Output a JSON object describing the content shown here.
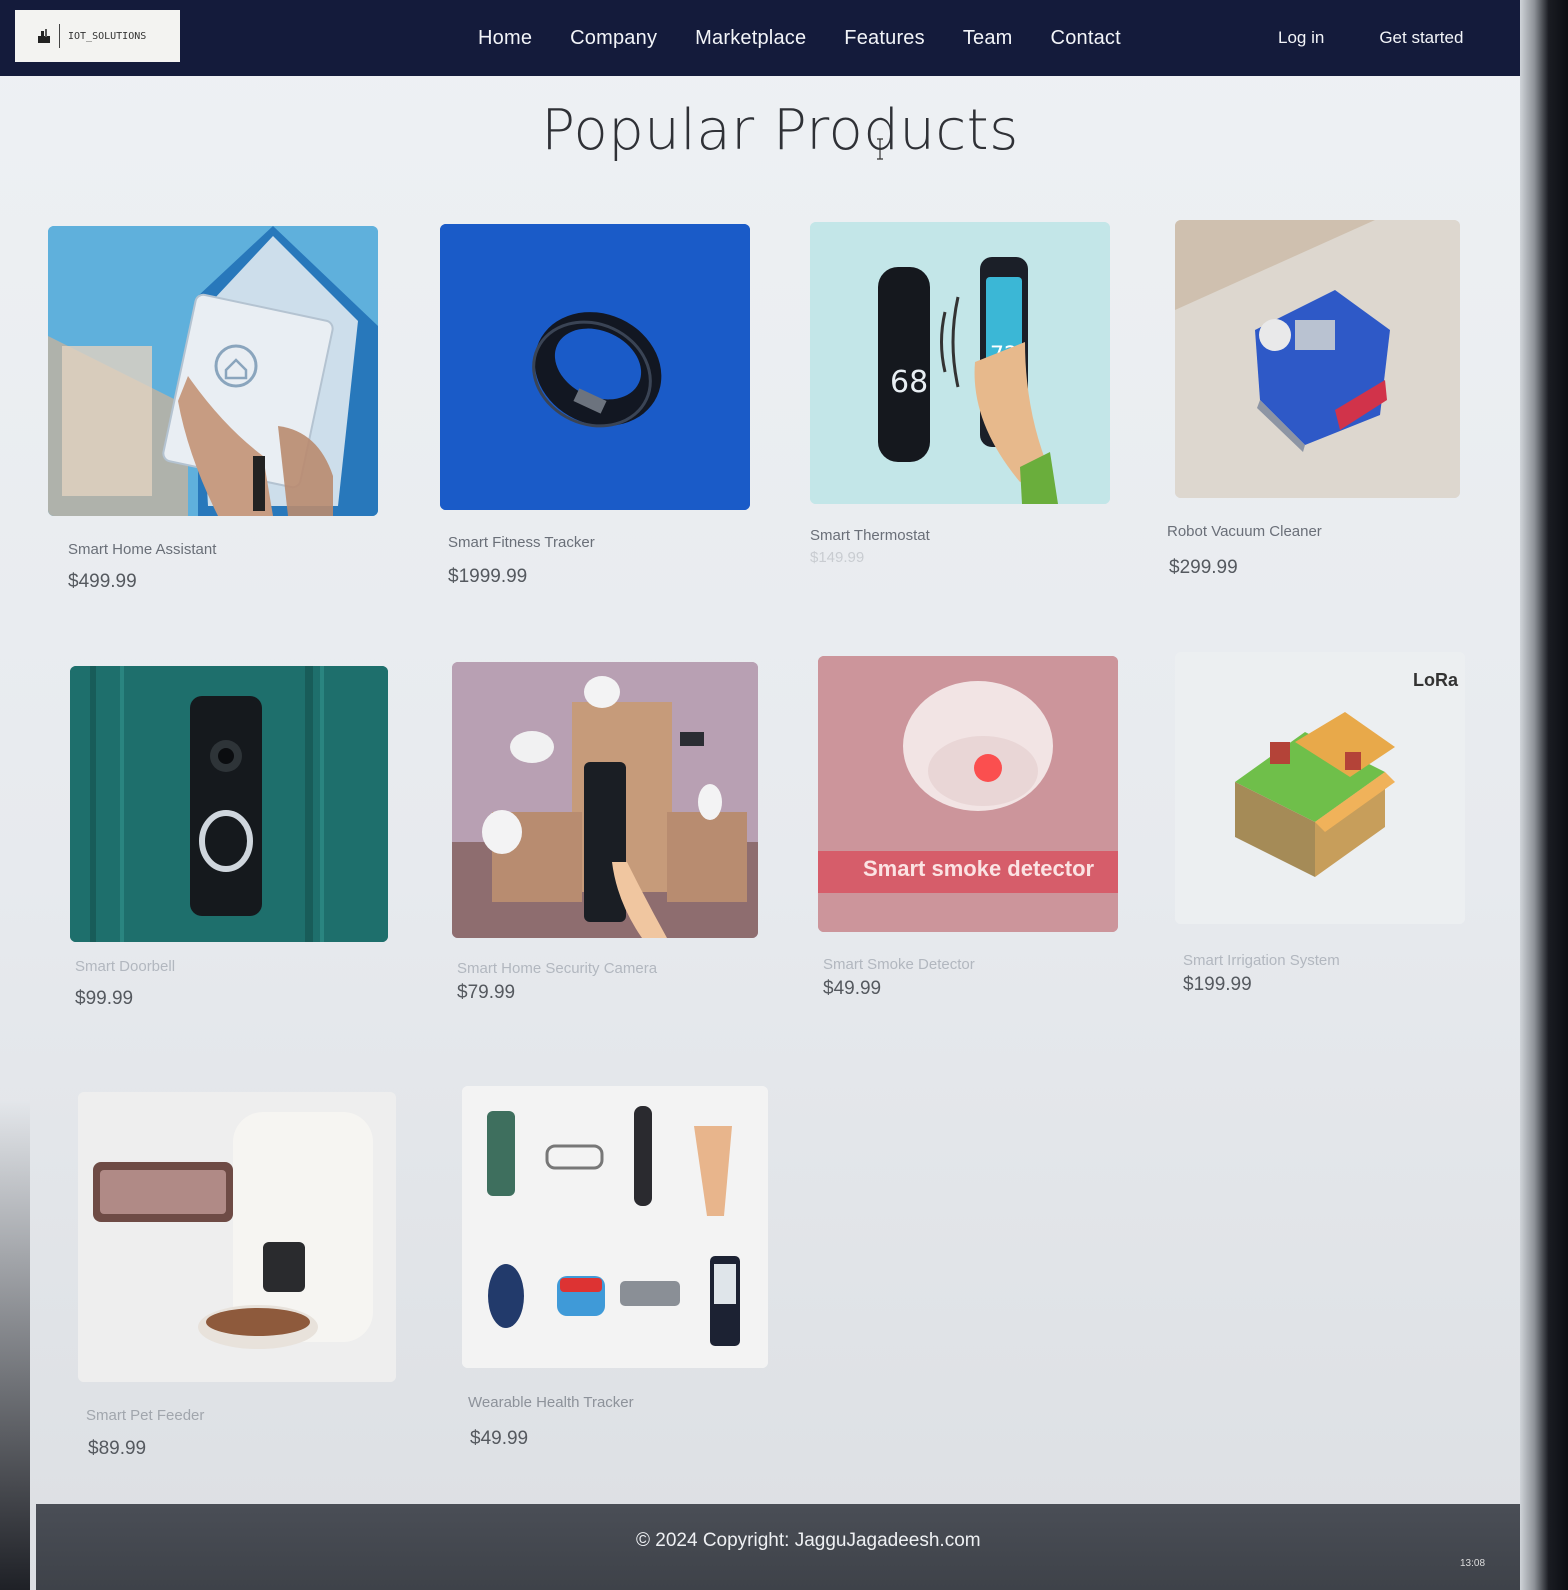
{
  "brand": {
    "logo_text": "IOT_SOLUTIONS"
  },
  "nav": {
    "links": [
      "Home",
      "Company",
      "Marketplace",
      "Features",
      "Team",
      "Contact"
    ],
    "login": "Log in",
    "get_started": "Get started"
  },
  "page": {
    "title": "Popular Products"
  },
  "products": [
    {
      "name": "Smart Home Assistant",
      "price": "$499.99",
      "image": "smart-home-tablet-image"
    },
    {
      "name": "Smart Fitness Tracker",
      "price": "$1999.99",
      "image": "smart-ring-image"
    },
    {
      "name": "Smart Thermostat",
      "price": "$149.99",
      "image": "thermostat-phone-image"
    },
    {
      "name": "Robot Vacuum Cleaner",
      "price": "$299.99",
      "image": "robot-vacuum-image"
    },
    {
      "name": "Smart Doorbell",
      "price": "$99.99",
      "image": "video-doorbell-image"
    },
    {
      "name": "Smart Home Security Camera",
      "price": "$79.99",
      "image": "security-camera-image"
    },
    {
      "name": "Smart Smoke Detector",
      "price": "$49.99",
      "image": "smoke-detector-image",
      "image_caption": "Smart smoke detector"
    },
    {
      "name": "Smart Irrigation System",
      "price": "$199.99",
      "image": "irrigation-farm-image",
      "image_caption": "LoRa"
    },
    {
      "name": "Smart Pet Feeder",
      "price": "$89.99",
      "image": "pet-feeder-image"
    },
    {
      "name": "Wearable Health Tracker",
      "price": "$49.99",
      "image": "wearable-devices-image"
    }
  ],
  "footer": {
    "copyright": "© 2024 Copyright: JagguJagadeesh.com"
  },
  "taskbar": {
    "clock": "13:08"
  },
  "colors": {
    "navbar": "#141b3b",
    "footer": "#43474e",
    "page_bg": "#eaedf0"
  }
}
